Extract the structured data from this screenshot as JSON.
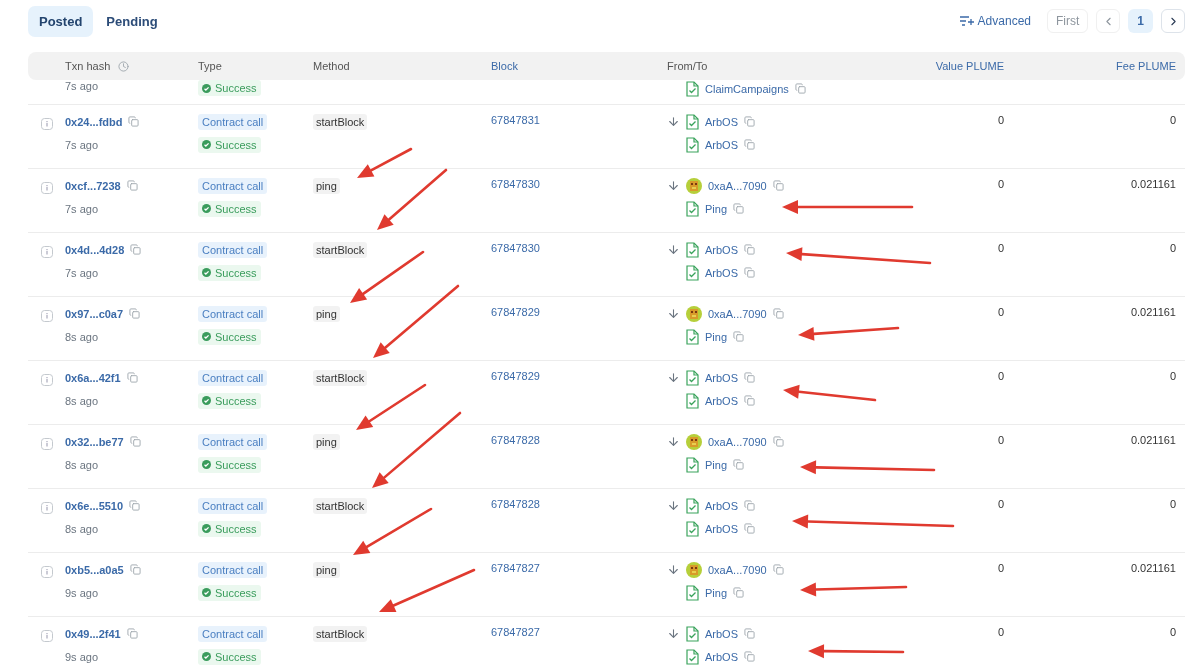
{
  "tabs": [
    {
      "label": "Posted",
      "selected": true
    },
    {
      "label": "Pending",
      "selected": false
    }
  ],
  "toolbar": {
    "advanced": "Advanced",
    "first": {
      "label": "First",
      "disabled": true
    },
    "prev": {
      "disabled": true
    },
    "page": {
      "label": "1",
      "selected": true
    },
    "next": {
      "disabled": false
    }
  },
  "table": {
    "columns": [
      "Txn hash",
      "Type",
      "Method",
      "Block",
      "From/To",
      "Value PLUME",
      "Fee PLUME"
    ],
    "partial_row": {
      "age": "7s ago",
      "status": "Success",
      "to": {
        "kind": "contract",
        "label": "ClaimCampaigns"
      }
    },
    "rows": [
      {
        "hash": "0x24...fdbd",
        "age": "7s ago",
        "type": "Contract call",
        "status": "Success",
        "method": "startBlock",
        "block": "67847831",
        "from": {
          "kind": "contract",
          "label": "ArbOS"
        },
        "to": {
          "kind": "contract",
          "label": "ArbOS"
        },
        "value": "0",
        "fee": "0"
      },
      {
        "hash": "0xcf...7238",
        "age": "7s ago",
        "type": "Contract call",
        "status": "Success",
        "method": "ping",
        "block": "67847830",
        "from": {
          "kind": "address",
          "label": "0xaA...7090"
        },
        "to": {
          "kind": "contract",
          "label": "Ping"
        },
        "value": "0",
        "fee": "0.021161"
      },
      {
        "hash": "0x4d...4d28",
        "age": "7s ago",
        "type": "Contract call",
        "status": "Success",
        "method": "startBlock",
        "block": "67847830",
        "from": {
          "kind": "contract",
          "label": "ArbOS"
        },
        "to": {
          "kind": "contract",
          "label": "ArbOS"
        },
        "value": "0",
        "fee": "0"
      },
      {
        "hash": "0x97...c0a7",
        "age": "8s ago",
        "type": "Contract call",
        "status": "Success",
        "method": "ping",
        "block": "67847829",
        "from": {
          "kind": "address",
          "label": "0xaA...7090"
        },
        "to": {
          "kind": "contract",
          "label": "Ping"
        },
        "value": "0",
        "fee": "0.021161"
      },
      {
        "hash": "0x6a...42f1",
        "age": "8s ago",
        "type": "Contract call",
        "status": "Success",
        "method": "startBlock",
        "block": "67847829",
        "from": {
          "kind": "contract",
          "label": "ArbOS"
        },
        "to": {
          "kind": "contract",
          "label": "ArbOS"
        },
        "value": "0",
        "fee": "0"
      },
      {
        "hash": "0x32...be77",
        "age": "8s ago",
        "type": "Contract call",
        "status": "Success",
        "method": "ping",
        "block": "67847828",
        "from": {
          "kind": "address",
          "label": "0xaA...7090"
        },
        "to": {
          "kind": "contract",
          "label": "Ping"
        },
        "value": "0",
        "fee": "0.021161"
      },
      {
        "hash": "0x6e...5510",
        "age": "8s ago",
        "type": "Contract call",
        "status": "Success",
        "method": "startBlock",
        "block": "67847828",
        "from": {
          "kind": "contract",
          "label": "ArbOS"
        },
        "to": {
          "kind": "contract",
          "label": "ArbOS"
        },
        "value": "0",
        "fee": "0"
      },
      {
        "hash": "0xb5...a0a5",
        "age": "9s ago",
        "type": "Contract call",
        "status": "Success",
        "method": "ping",
        "block": "67847827",
        "from": {
          "kind": "address",
          "label": "0xaA...7090"
        },
        "to": {
          "kind": "contract",
          "label": "Ping"
        },
        "value": "0",
        "fee": "0.021161"
      },
      {
        "hash": "0x49...2f41",
        "age": "9s ago",
        "type": "Contract call",
        "status": "Success",
        "method": "startBlock",
        "block": "67847827",
        "from": {
          "kind": "contract",
          "label": "ArbOS"
        },
        "to": {
          "kind": "contract",
          "label": "ArbOS"
        },
        "value": "0",
        "fee": "0"
      }
    ]
  }
}
